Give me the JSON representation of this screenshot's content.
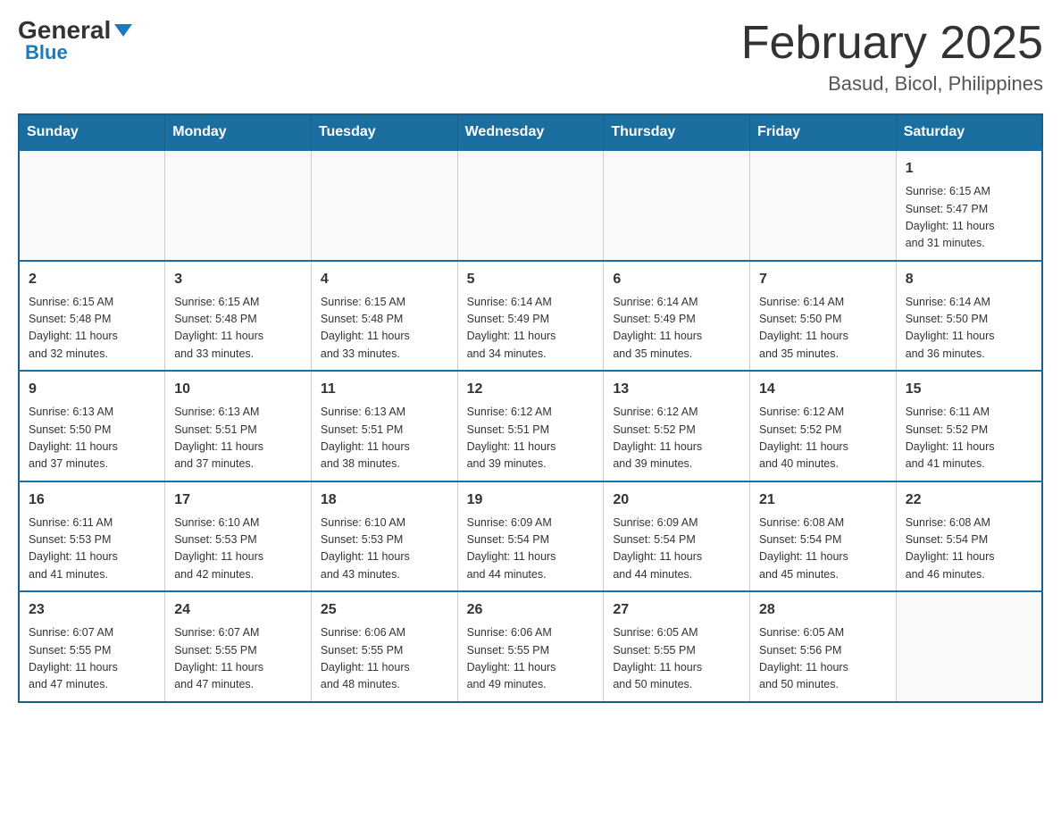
{
  "header": {
    "logo_general": "General",
    "logo_blue": "Blue",
    "month_title": "February 2025",
    "location": "Basud, Bicol, Philippines"
  },
  "days_of_week": [
    "Sunday",
    "Monday",
    "Tuesday",
    "Wednesday",
    "Thursday",
    "Friday",
    "Saturday"
  ],
  "weeks": [
    {
      "days": [
        {
          "number": "",
          "info": ""
        },
        {
          "number": "",
          "info": ""
        },
        {
          "number": "",
          "info": ""
        },
        {
          "number": "",
          "info": ""
        },
        {
          "number": "",
          "info": ""
        },
        {
          "number": "",
          "info": ""
        },
        {
          "number": "1",
          "info": "Sunrise: 6:15 AM\nSunset: 5:47 PM\nDaylight: 11 hours\nand 31 minutes."
        }
      ]
    },
    {
      "days": [
        {
          "number": "2",
          "info": "Sunrise: 6:15 AM\nSunset: 5:48 PM\nDaylight: 11 hours\nand 32 minutes."
        },
        {
          "number": "3",
          "info": "Sunrise: 6:15 AM\nSunset: 5:48 PM\nDaylight: 11 hours\nand 33 minutes."
        },
        {
          "number": "4",
          "info": "Sunrise: 6:15 AM\nSunset: 5:48 PM\nDaylight: 11 hours\nand 33 minutes."
        },
        {
          "number": "5",
          "info": "Sunrise: 6:14 AM\nSunset: 5:49 PM\nDaylight: 11 hours\nand 34 minutes."
        },
        {
          "number": "6",
          "info": "Sunrise: 6:14 AM\nSunset: 5:49 PM\nDaylight: 11 hours\nand 35 minutes."
        },
        {
          "number": "7",
          "info": "Sunrise: 6:14 AM\nSunset: 5:50 PM\nDaylight: 11 hours\nand 35 minutes."
        },
        {
          "number": "8",
          "info": "Sunrise: 6:14 AM\nSunset: 5:50 PM\nDaylight: 11 hours\nand 36 minutes."
        }
      ]
    },
    {
      "days": [
        {
          "number": "9",
          "info": "Sunrise: 6:13 AM\nSunset: 5:50 PM\nDaylight: 11 hours\nand 37 minutes."
        },
        {
          "number": "10",
          "info": "Sunrise: 6:13 AM\nSunset: 5:51 PM\nDaylight: 11 hours\nand 37 minutes."
        },
        {
          "number": "11",
          "info": "Sunrise: 6:13 AM\nSunset: 5:51 PM\nDaylight: 11 hours\nand 38 minutes."
        },
        {
          "number": "12",
          "info": "Sunrise: 6:12 AM\nSunset: 5:51 PM\nDaylight: 11 hours\nand 39 minutes."
        },
        {
          "number": "13",
          "info": "Sunrise: 6:12 AM\nSunset: 5:52 PM\nDaylight: 11 hours\nand 39 minutes."
        },
        {
          "number": "14",
          "info": "Sunrise: 6:12 AM\nSunset: 5:52 PM\nDaylight: 11 hours\nand 40 minutes."
        },
        {
          "number": "15",
          "info": "Sunrise: 6:11 AM\nSunset: 5:52 PM\nDaylight: 11 hours\nand 41 minutes."
        }
      ]
    },
    {
      "days": [
        {
          "number": "16",
          "info": "Sunrise: 6:11 AM\nSunset: 5:53 PM\nDaylight: 11 hours\nand 41 minutes."
        },
        {
          "number": "17",
          "info": "Sunrise: 6:10 AM\nSunset: 5:53 PM\nDaylight: 11 hours\nand 42 minutes."
        },
        {
          "number": "18",
          "info": "Sunrise: 6:10 AM\nSunset: 5:53 PM\nDaylight: 11 hours\nand 43 minutes."
        },
        {
          "number": "19",
          "info": "Sunrise: 6:09 AM\nSunset: 5:54 PM\nDaylight: 11 hours\nand 44 minutes."
        },
        {
          "number": "20",
          "info": "Sunrise: 6:09 AM\nSunset: 5:54 PM\nDaylight: 11 hours\nand 44 minutes."
        },
        {
          "number": "21",
          "info": "Sunrise: 6:08 AM\nSunset: 5:54 PM\nDaylight: 11 hours\nand 45 minutes."
        },
        {
          "number": "22",
          "info": "Sunrise: 6:08 AM\nSunset: 5:54 PM\nDaylight: 11 hours\nand 46 minutes."
        }
      ]
    },
    {
      "days": [
        {
          "number": "23",
          "info": "Sunrise: 6:07 AM\nSunset: 5:55 PM\nDaylight: 11 hours\nand 47 minutes."
        },
        {
          "number": "24",
          "info": "Sunrise: 6:07 AM\nSunset: 5:55 PM\nDaylight: 11 hours\nand 47 minutes."
        },
        {
          "number": "25",
          "info": "Sunrise: 6:06 AM\nSunset: 5:55 PM\nDaylight: 11 hours\nand 48 minutes."
        },
        {
          "number": "26",
          "info": "Sunrise: 6:06 AM\nSunset: 5:55 PM\nDaylight: 11 hours\nand 49 minutes."
        },
        {
          "number": "27",
          "info": "Sunrise: 6:05 AM\nSunset: 5:55 PM\nDaylight: 11 hours\nand 50 minutes."
        },
        {
          "number": "28",
          "info": "Sunrise: 6:05 AM\nSunset: 5:56 PM\nDaylight: 11 hours\nand 50 minutes."
        },
        {
          "number": "",
          "info": ""
        }
      ]
    }
  ]
}
